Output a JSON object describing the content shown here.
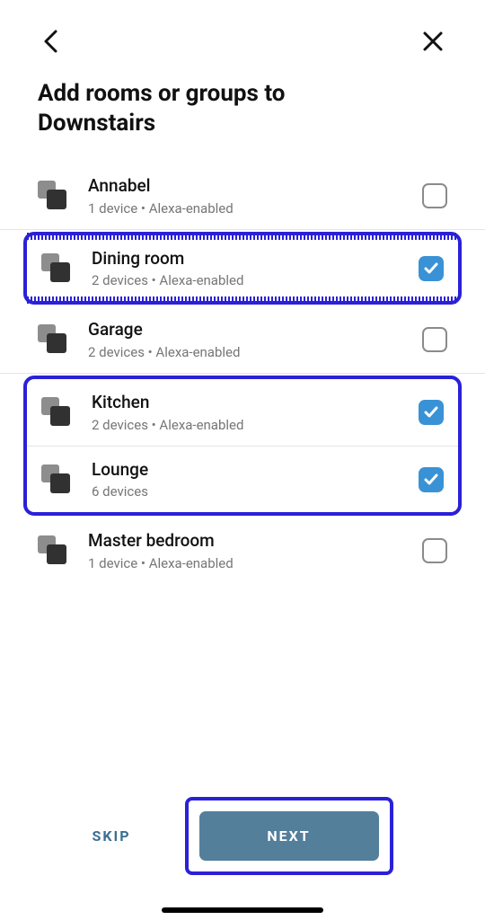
{
  "header": {
    "title_line1": "Add rooms or groups to",
    "title_line2": "Downstairs"
  },
  "rooms": [
    {
      "name": "Annabel",
      "sub": "1 device • Alexa-enabled",
      "checked": false
    },
    {
      "name": "Dining room",
      "sub": "2 devices • Alexa-enabled",
      "checked": true
    },
    {
      "name": "Garage",
      "sub": "2 devices • Alexa-enabled",
      "checked": false
    },
    {
      "name": "Kitchen",
      "sub": "2 devices • Alexa-enabled",
      "checked": true
    },
    {
      "name": "Lounge",
      "sub": "6 devices",
      "checked": true
    },
    {
      "name": "Master bedroom",
      "sub": "1 device • Alexa-enabled",
      "checked": false
    }
  ],
  "footer": {
    "skip_label": "SKIP",
    "next_label": "NEXT"
  },
  "colors": {
    "highlight": "#2a21d7",
    "checkbox_checked": "#3992d6",
    "primary_button": "#547f9b"
  }
}
